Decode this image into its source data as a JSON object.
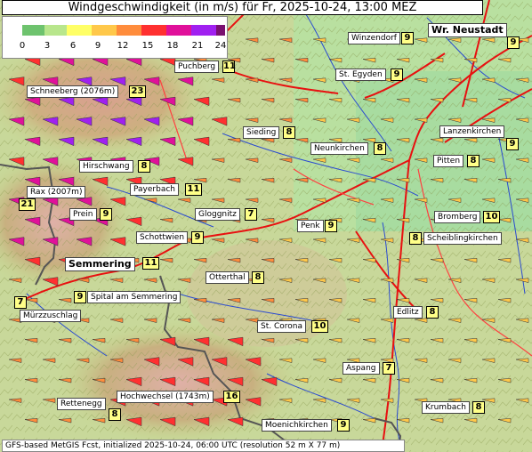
{
  "title": "Windgeschwindigkeit (in m/s) für Fr, 2025-10-24, 13:00 MEZ",
  "legend": {
    "ticks": [
      "0",
      "3",
      "6",
      "9",
      "12",
      "15",
      "18",
      "21",
      "24"
    ],
    "colors": [
      "#6ec36e",
      "#b8e68c",
      "#ffff66",
      "#ffc84a",
      "#ff8c3c",
      "#ff3030",
      "#e0109a",
      "#a020f0",
      "#7a1070"
    ]
  },
  "locations": [
    {
      "name": "Winzendorf",
      "value": "9"
    },
    {
      "name": "Wr. Neustadt",
      "value": "9"
    },
    {
      "name": "Puchberg",
      "value": "11"
    },
    {
      "name": "St. Egyden",
      "value": "9"
    },
    {
      "name": "Schneeberg (2076m)",
      "value": "23"
    },
    {
      "name": "Sieding",
      "value": "8"
    },
    {
      "name": "Neunkirchen",
      "value": "8"
    },
    {
      "name": "Lanzenkirchen",
      "value": "9"
    },
    {
      "name": "Pitten",
      "value": "8"
    },
    {
      "name": "Hirschwang",
      "value": "8"
    },
    {
      "name": "Payerbach",
      "value": "11"
    },
    {
      "name": "Rax (2007m)",
      "value": "21"
    },
    {
      "name": "Prein",
      "value": "9"
    },
    {
      "name": "Gloggnitz",
      "value": "7"
    },
    {
      "name": "Bromberg",
      "value": "10"
    },
    {
      "name": "Penk",
      "value": "9"
    },
    {
      "name": "Schottwien",
      "value": "9"
    },
    {
      "name": "Scheiblingkirchen",
      "value": "8"
    },
    {
      "name": "Semmering",
      "value": "11"
    },
    {
      "name": "Otterthal",
      "value": "8"
    },
    {
      "name": "Spital am Semmering",
      "value": "9"
    },
    {
      "name": "Mürzzuschlag",
      "value": "7"
    },
    {
      "name": "Edlitz",
      "value": "8"
    },
    {
      "name": "St. Corona",
      "value": "10"
    },
    {
      "name": "Aspang",
      "value": "7"
    },
    {
      "name": "Hochwechsel (1743m)",
      "value": "16"
    },
    {
      "name": "Rettenegg",
      "value": "8"
    },
    {
      "name": "Krumbach",
      "value": "8"
    },
    {
      "name": "Moenichkirchen",
      "value": "9"
    }
  ],
  "footer": "GFS-based MetGIS Fcst, initialized 2025-10-24, 06:00 UTC  (resolution 52 m X 77 m)"
}
